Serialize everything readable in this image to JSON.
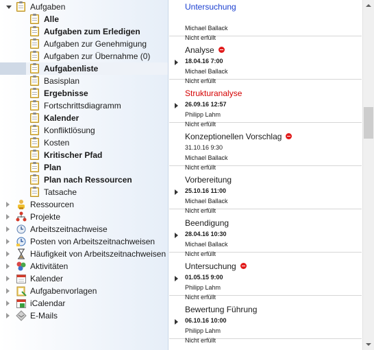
{
  "nav": {
    "tasks_root": "Aufgaben",
    "task_views": [
      {
        "label": "Alle",
        "bold": true
      },
      {
        "label": "Aufgaben zum Erledigen",
        "bold": true
      },
      {
        "label": "Aufgaben zur Genehmigung",
        "bold": false
      },
      {
        "label": "Aufgaben zur Übernahme (0)",
        "bold": false
      },
      {
        "label": "Aufgabenliste",
        "bold": true,
        "selected": true
      },
      {
        "label": "Basisplan",
        "bold": false
      },
      {
        "label": "Ergebnisse",
        "bold": true
      },
      {
        "label": "Fortschrittsdiagramm",
        "bold": false
      },
      {
        "label": "Kalender",
        "bold": true
      },
      {
        "label": "Konfliktlösung",
        "bold": false
      },
      {
        "label": "Kosten",
        "bold": false
      },
      {
        "label": "Kritischer Pfad",
        "bold": true
      },
      {
        "label": "Plan",
        "bold": true
      },
      {
        "label": "Plan nach Ressourcen",
        "bold": true
      },
      {
        "label": "Tatsache",
        "bold": false
      }
    ],
    "modules": [
      {
        "label": "Ressourcen",
        "icon": "resources-icon"
      },
      {
        "label": "Projekte",
        "icon": "projects-icon"
      },
      {
        "label": "Arbeitszeitnachweise",
        "icon": "timesheet-icon"
      },
      {
        "label": "Posten von Arbeitszeitnachweisen",
        "icon": "timesheet-items-icon"
      },
      {
        "label": "Häufigkeit von Arbeitszeitnachweisen",
        "icon": "hourglass-icon"
      },
      {
        "label": "Aktivitäten",
        "icon": "activities-icon"
      },
      {
        "label": "Kalender",
        "icon": "calendar-icon"
      },
      {
        "label": "Aufgabenvorlagen",
        "icon": "task-templates-icon"
      },
      {
        "label": "iCalendar",
        "icon": "icalendar-icon"
      },
      {
        "label": "E-Mails",
        "icon": "email-icon"
      }
    ]
  },
  "tasks": [
    {
      "title": "Untersuchung",
      "title_color": "blue",
      "date": "",
      "person": "Michael Ballack",
      "status": "Nicht erfüllt",
      "blocked": false,
      "date_bold": false,
      "has_arrow": false
    },
    {
      "title": "Analyse",
      "title_color": "normal",
      "date": "18.04.16 7:00",
      "person": "Michael Ballack",
      "status": "Nicht erfüllt",
      "blocked": true,
      "date_bold": true,
      "has_arrow": true
    },
    {
      "title": "Strukturanalyse",
      "title_color": "red",
      "date": "26.09.16 12:57",
      "person": "Philipp Lahm",
      "status": "Nicht erfüllt",
      "blocked": false,
      "date_bold": true,
      "has_arrow": true
    },
    {
      "title": "Konzeptionellen Vorschlag",
      "title_color": "normal",
      "date": "31.10.16 9:30",
      "person": "Michael Ballack",
      "status": "Nicht erfüllt",
      "blocked": true,
      "date_bold": false,
      "has_arrow": false
    },
    {
      "title": "Vorbereitung",
      "title_color": "normal",
      "date": "25.10.16 11:00",
      "person": "Michael Ballack",
      "status": "Nicht erfüllt",
      "blocked": false,
      "date_bold": true,
      "has_arrow": true
    },
    {
      "title": "Beendigung",
      "title_color": "normal",
      "date": "28.04.16 10:30",
      "person": "Michael Ballack",
      "status": "Nicht erfüllt",
      "blocked": false,
      "date_bold": true,
      "has_arrow": true
    },
    {
      "title": "Untersuchung",
      "title_color": "normal",
      "date": "01.05.15 9:00",
      "person": "Philipp Lahm",
      "status": "Nicht erfüllt",
      "blocked": true,
      "date_bold": true,
      "has_arrow": true
    },
    {
      "title": "Bewertung Führung",
      "title_color": "normal",
      "date": "06.10.16 10:00",
      "person": "Philipp Lahm",
      "status": "Nicht erfüllt",
      "blocked": false,
      "date_bold": true,
      "has_arrow": true
    }
  ],
  "colors": {
    "title_red": "#d40000",
    "title_blue": "#1a3fd0",
    "blocked_icon": "#e11b1b",
    "selection": "#cfd9e6"
  }
}
